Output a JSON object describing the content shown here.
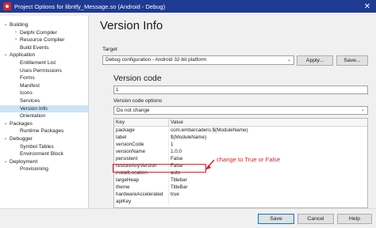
{
  "window": {
    "title": "Project Options for libntfy_Message.so  (Android - Debug)",
    "close_glyph": "✕"
  },
  "tree": [
    {
      "label": "Building",
      "level": 0,
      "arrow": "⌄",
      "selected": false
    },
    {
      "label": "Delphi Compiler",
      "level": 1,
      "arrow": "›",
      "selected": false
    },
    {
      "label": "Resource Compiler",
      "level": 1,
      "arrow": "›",
      "selected": false
    },
    {
      "label": "Build Events",
      "level": 1,
      "arrow": "",
      "selected": false
    },
    {
      "label": "Application",
      "level": 0,
      "arrow": "⌄",
      "selected": false
    },
    {
      "label": "Entitlement List",
      "level": 1,
      "arrow": "",
      "selected": false
    },
    {
      "label": "Uses Permissions",
      "level": 1,
      "arrow": "",
      "selected": false
    },
    {
      "label": "Forms",
      "level": 1,
      "arrow": "",
      "selected": false
    },
    {
      "label": "Manifest",
      "level": 1,
      "arrow": "",
      "selected": false
    },
    {
      "label": "Icons",
      "level": 1,
      "arrow": "",
      "selected": false
    },
    {
      "label": "Services",
      "level": 1,
      "arrow": "",
      "selected": false
    },
    {
      "label": "Version Info",
      "level": 1,
      "arrow": "",
      "selected": true
    },
    {
      "label": "Orientation",
      "level": 1,
      "arrow": "",
      "selected": false
    },
    {
      "label": "Packages",
      "level": 0,
      "arrow": "⌄",
      "selected": false
    },
    {
      "label": "Runtime Packages",
      "level": 1,
      "arrow": "",
      "selected": false
    },
    {
      "label": "Debugger",
      "level": 0,
      "arrow": "⌄",
      "selected": false
    },
    {
      "label": "Symbol Tables",
      "level": 1,
      "arrow": "",
      "selected": false
    },
    {
      "label": "Environment Block",
      "level": 1,
      "arrow": "",
      "selected": false
    },
    {
      "label": "Deployment",
      "level": 0,
      "arrow": "⌄",
      "selected": false
    },
    {
      "label": "Provisioning",
      "level": 1,
      "arrow": "",
      "selected": false
    }
  ],
  "main": {
    "title": "Version Info",
    "target_label": "Target",
    "target_value": "Debug configuration - Android 32-bit platform",
    "apply_label": "Apply...",
    "save_label": "Save...",
    "version_code_title": "Version code",
    "version_code_value": "1",
    "version_code_options_label": "Version code options",
    "version_code_options_value": "Do not change",
    "dropdown_glyph": "⌄"
  },
  "grid": {
    "header_key": "Key",
    "header_value": "Value",
    "rows": [
      {
        "key": "package",
        "value": "com.embarcadero.$(ModuleName)"
      },
      {
        "key": "label",
        "value": "$(ModuleName)"
      },
      {
        "key": "versionCode",
        "value": "1"
      },
      {
        "key": "versionName",
        "value": "1.0.0"
      },
      {
        "key": "persistent",
        "value": "False"
      },
      {
        "key": "restoreAnyVersion",
        "value": "False"
      },
      {
        "key": "installLocation",
        "value": "auto"
      },
      {
        "key": "largeHeap",
        "value": "Titlebar"
      },
      {
        "key": "theme",
        "value": "TitleBar"
      },
      {
        "key": "hardwareAccelerated",
        "value": "true"
      },
      {
        "key": "apiKey",
        "value": ""
      }
    ]
  },
  "annotation": {
    "text": "change to True or False",
    "color": "#e0202a"
  },
  "footer": {
    "save_label": "Save",
    "cancel_label": "Cancel",
    "help_label": "Help"
  }
}
